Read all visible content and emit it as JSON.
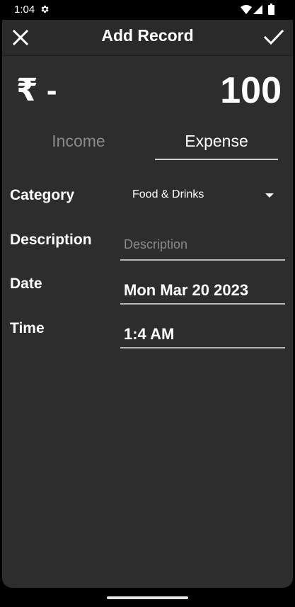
{
  "status_bar": {
    "time": "1:04",
    "icons": [
      "settings-gear-icon",
      "wifi-icon",
      "signal-icon",
      "battery-icon"
    ]
  },
  "toolbar": {
    "title": "Add Record",
    "close_icon": "close-icon",
    "confirm_icon": "check-icon"
  },
  "amount": {
    "currency": "₹ -",
    "value": "100"
  },
  "tabs": [
    {
      "label": "Income",
      "selected": false
    },
    {
      "label": "Expense",
      "selected": true
    }
  ],
  "form": {
    "category": {
      "label": "Category",
      "value": "Food & Drinks"
    },
    "description": {
      "label": "Description",
      "value": "",
      "placeholder": "Description"
    },
    "date": {
      "label": "Date",
      "value": "Mon Mar 20 2023"
    },
    "time": {
      "label": "Time",
      "value": "1:4 AM"
    }
  },
  "colors": {
    "background": "#2d2d2d",
    "toolbar": "#2a2a2a",
    "text": "#ffffff",
    "muted": "#8a8a8a",
    "underline": "#b8b8b8"
  }
}
